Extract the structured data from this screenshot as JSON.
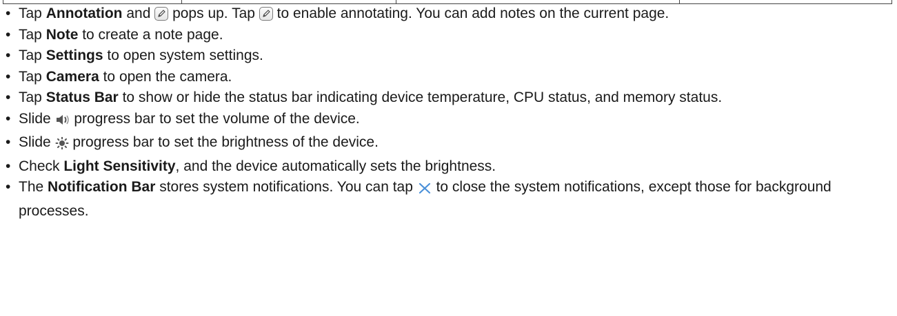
{
  "bullets": [
    {
      "parts": [
        {
          "t": "Tap "
        },
        {
          "b": "Annotation"
        },
        {
          "t": " and "
        },
        {
          "icon": "pen-icon"
        },
        {
          "t": " pops up. Tap "
        },
        {
          "icon": "pen-icon"
        },
        {
          "t": " to enable annotating. You can add notes on the current page."
        }
      ]
    },
    {
      "parts": [
        {
          "t": "Tap "
        },
        {
          "b": "Note"
        },
        {
          "t": " to create a note page."
        }
      ]
    },
    {
      "parts": [
        {
          "t": "Tap "
        },
        {
          "b": "Settings"
        },
        {
          "t": " to open system settings."
        }
      ]
    },
    {
      "parts": [
        {
          "t": "Tap "
        },
        {
          "b": "Camera"
        },
        {
          "t": " to open the camera."
        }
      ]
    },
    {
      "parts": [
        {
          "t": "Tap "
        },
        {
          "b": "Status Bar"
        },
        {
          "t": " to show or hide the status bar indicating device temperature, CPU status, and memory status."
        }
      ]
    },
    {
      "parts": [
        {
          "t": "Slide "
        },
        {
          "icon": "volume-icon"
        },
        {
          "t": " progress bar to set the volume of the device."
        }
      ]
    },
    {
      "parts": [
        {
          "t": "Slide "
        },
        {
          "icon": "brightness-icon"
        },
        {
          "t": " progress bar to set the brightness of the device."
        }
      ]
    },
    {
      "parts": [
        {
          "t": "Check "
        },
        {
          "b": "Light Sensitivity"
        },
        {
          "t": ", and the device automatically sets the brightness."
        }
      ]
    },
    {
      "parts": [
        {
          "t": "The "
        },
        {
          "b": "Notification Bar"
        },
        {
          "t": " stores system notifications. You can tap "
        },
        {
          "icon": "close-icon"
        },
        {
          "t": " to close the system notifications, except those for background processes."
        }
      ]
    }
  ],
  "colors": {
    "close_icon": "#4a90d9",
    "icon_gray": "#555555"
  }
}
